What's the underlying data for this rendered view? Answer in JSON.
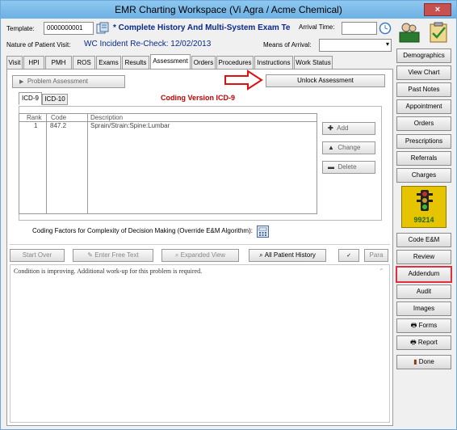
{
  "window": {
    "title": "EMR Charting Workspace (Vi Agra / Acme Chemical)",
    "close": "×"
  },
  "header": {
    "template_label": "Template:",
    "template_value": "0000000001",
    "template_name": "* Complete History And Multi-System Exam Te",
    "arrival_time_label": "Arrival Time:",
    "arrival_time_value": "",
    "nature_label": "Nature of Patient Visit:",
    "nature_value": "WC Incident Re-Check: 12/02/2013",
    "means_label": "Means of Arrival:",
    "means_value": ""
  },
  "tabs": [
    "Visit",
    "HPI",
    "PMH",
    "ROS",
    "Exams",
    "Results",
    "Assessment",
    "Orders",
    "Procedures",
    "Instructions",
    "Work Status"
  ],
  "active_tab": "Assessment",
  "assessment": {
    "problem_assessment": "Problem Assessment",
    "unlock_button": "Unlock Assessment",
    "code_tabs": [
      "ICD-9",
      "ICD-10"
    ],
    "coding_version": "Coding Version ICD-9",
    "columns": [
      "Rank",
      "Code",
      "Description"
    ],
    "rows": [
      {
        "rank": "1",
        "code": "847.2",
        "description": "Sprain/Strain:Spine:Lumbar"
      }
    ],
    "add_button": "Add",
    "change_button": "Change",
    "delete_button": "Delete",
    "coding_factors": "Coding Factors for Complexity of Decision Making (Override E&M Algorithm):"
  },
  "toolbar": {
    "start_over": "Start Over",
    "enter_free_text": "Enter Free Text",
    "expanded_view": "Expanded View",
    "all_patient_history": "All Patient History",
    "para": "Para"
  },
  "note_text": "Condition is improving. Additional work-up for this problem is required.",
  "sidebar": {
    "demographics": "Demographics",
    "view_chart": "View Chart",
    "past_notes": "Past Notes",
    "appointment": "Appointment",
    "orders": "Orders",
    "prescriptions": "Prescriptions",
    "referrals": "Referrals",
    "charges": "Charges",
    "em_code": "99214",
    "code_em": "Code E&M",
    "review": "Review",
    "addendum": "Addendum",
    "audit": "Audit",
    "images": "Images",
    "forms": "Forms",
    "report": "Report",
    "done": "Done"
  },
  "colors": {
    "title_bar": "#7bbbe8",
    "template_name_blue": "#0a2a8a",
    "coding_version_red": "#c00000",
    "arrow_red": "#e01010",
    "addendum_border": "#e03040",
    "em_yellow": "#e6c500"
  }
}
